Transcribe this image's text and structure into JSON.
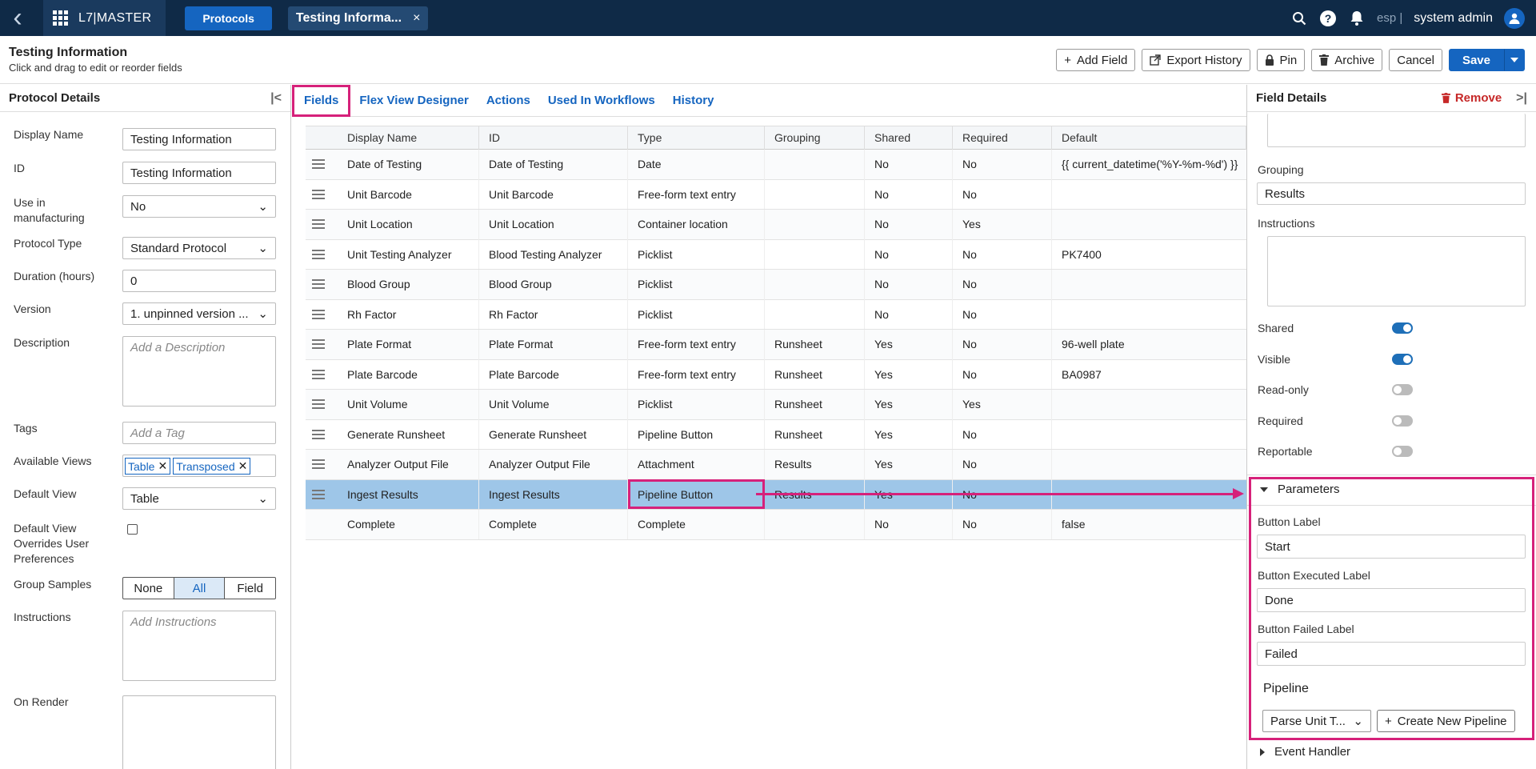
{
  "topbar": {
    "brand": "L7|MASTER",
    "nav_label": "Protocols",
    "open_tab": "Testing Informa...",
    "tab_close": "×",
    "help": "?",
    "workspace": "esp |",
    "user": "system admin"
  },
  "header": {
    "title": "Testing Information",
    "subtitle": "Click and drag to edit or reorder fields",
    "add_field": "Add Field",
    "export_history": "Export History",
    "pin": "Pin",
    "archive": "Archive",
    "cancel": "Cancel",
    "save": "Save"
  },
  "left": {
    "title": "Protocol Details",
    "display_name_label": "Display Name",
    "display_name": "Testing Information",
    "id_label": "ID",
    "id": "Testing Information",
    "use_mfg_label": "Use in manufacturing",
    "use_mfg": "No",
    "protocol_type_label": "Protocol Type",
    "protocol_type": "Standard Protocol",
    "duration_label": "Duration (hours)",
    "duration": "0",
    "version_label": "Version",
    "version": "1. unpinned version ...",
    "description_label": "Description",
    "description_placeholder": "Add a Description",
    "tags_label": "Tags",
    "tags_placeholder": "Add a Tag",
    "views_label": "Available Views",
    "views": [
      "Table",
      "Transposed"
    ],
    "default_view_label": "Default View",
    "default_view": "Table",
    "override_label": "Default View Overrides User Preferences",
    "group_label": "Group Samples",
    "group_options": [
      "None",
      "All",
      "Field"
    ],
    "instructions_label": "Instructions",
    "instructions_placeholder": "Add Instructions",
    "on_render_label": "On Render"
  },
  "tabs": [
    "Fields",
    "Flex View Designer",
    "Actions",
    "Used In Workflows",
    "History"
  ],
  "table": {
    "columns": [
      "Display Name",
      "ID",
      "Type",
      "Grouping",
      "Shared",
      "Required",
      "Default"
    ],
    "rows": [
      [
        "Date of Testing",
        "Date of Testing",
        "Date",
        "",
        "No",
        "No",
        "{{ current_datetime('%Y-%m-%d') }}"
      ],
      [
        "Unit Barcode",
        "Unit Barcode",
        "Free-form text entry",
        "",
        "No",
        "No",
        ""
      ],
      [
        "Unit Location",
        "Unit Location",
        "Container location",
        "",
        "No",
        "Yes",
        ""
      ],
      [
        "Unit Testing Analyzer",
        "Blood Testing Analyzer",
        "Picklist",
        "",
        "No",
        "No",
        "PK7400"
      ],
      [
        "Blood Group",
        "Blood Group",
        "Picklist",
        "",
        "No",
        "No",
        ""
      ],
      [
        "Rh Factor",
        "Rh Factor",
        "Picklist",
        "",
        "No",
        "No",
        ""
      ],
      [
        "Plate Format",
        "Plate Format",
        "Free-form text entry",
        "Runsheet",
        "Yes",
        "No",
        "96-well plate"
      ],
      [
        "Plate Barcode",
        "Plate Barcode",
        "Free-form text entry",
        "Runsheet",
        "Yes",
        "No",
        "BA0987"
      ],
      [
        "Unit Volume",
        "Unit Volume",
        "Picklist",
        "Runsheet",
        "Yes",
        "Yes",
        ""
      ],
      [
        "Generate Runsheet",
        "Generate Runsheet",
        "Pipeline Button",
        "Runsheet",
        "Yes",
        "No",
        ""
      ],
      [
        "Analyzer Output File",
        "Analyzer Output File",
        "Attachment",
        "Results",
        "Yes",
        "No",
        ""
      ],
      [
        "Ingest Results",
        "Ingest Results",
        "Pipeline Button",
        "Results",
        "Yes",
        "No",
        ""
      ],
      [
        "Complete",
        "Complete",
        "Complete",
        "",
        "No",
        "No",
        "false"
      ]
    ]
  },
  "right": {
    "title": "Field Details",
    "remove": "Remove",
    "grouping_label": "Grouping",
    "grouping": "Results",
    "instructions_label": "Instructions",
    "shared_label": "Shared",
    "visible_label": "Visible",
    "readonly_label": "Read-only",
    "required_label": "Required",
    "reportable_label": "Reportable",
    "params_title": "Parameters",
    "button_label_label": "Button Label",
    "button_label": "Start",
    "exec_label_label": "Button Executed Label",
    "exec_label": "Done",
    "failed_label_label": "Button Failed Label",
    "failed_label": "Failed",
    "pipeline_label": "Pipeline",
    "pipeline_value": "Parse Unit T...",
    "create_pipeline": "Create New Pipeline",
    "event_handler": "Event Handler"
  },
  "colors": {
    "accent": "#1565c0",
    "highlight": "#d6217a",
    "topbar": "#0f2a47",
    "selected_row": "#9ec6e8"
  }
}
